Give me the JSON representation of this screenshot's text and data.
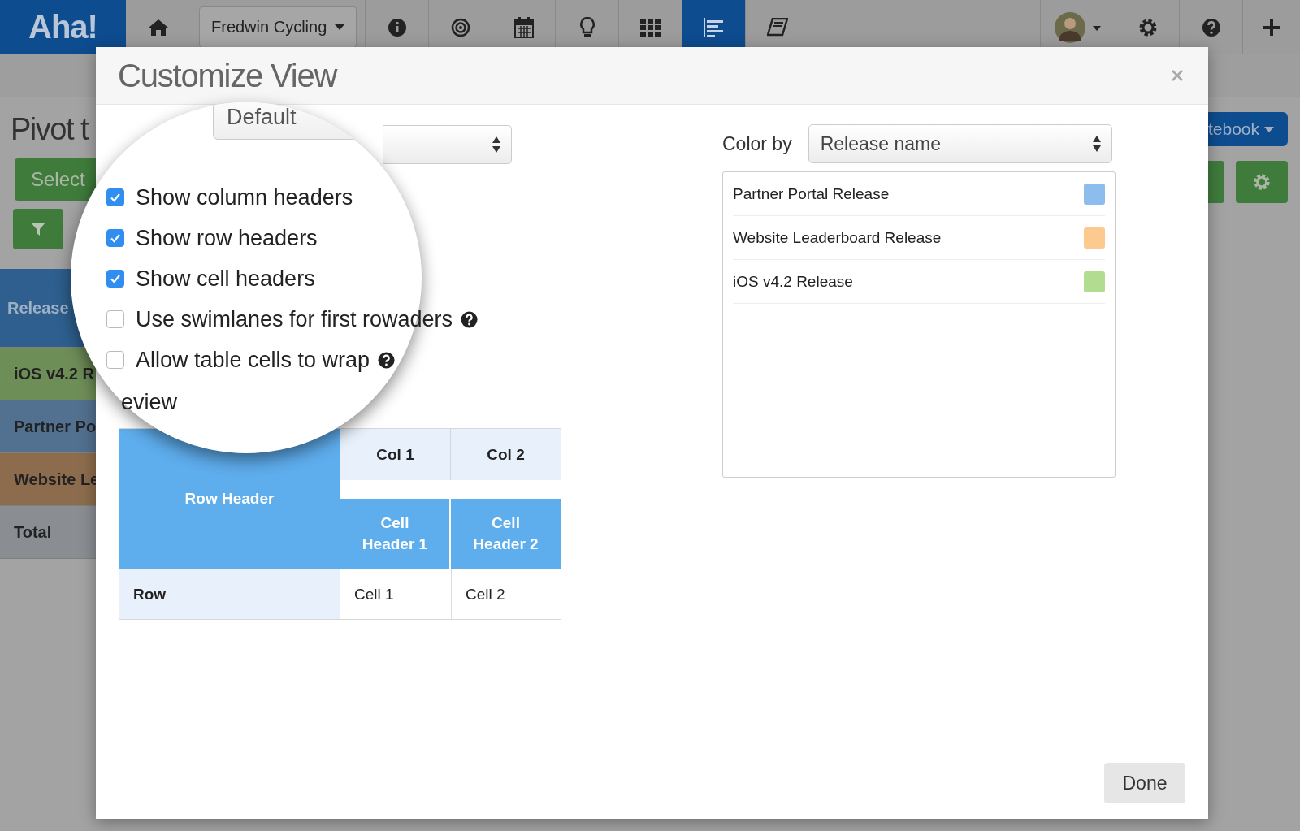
{
  "nav": {
    "logo": "Aha!",
    "workspace": "Fredwin Cycling",
    "items": [
      {
        "kind": "info",
        "selected": false
      },
      {
        "kind": "target",
        "selected": false
      },
      {
        "kind": "calendar",
        "selected": false
      },
      {
        "kind": "bulb",
        "selected": false
      },
      {
        "kind": "grid",
        "selected": false
      },
      {
        "kind": "list",
        "selected": true
      },
      {
        "kind": "book",
        "selected": false
      }
    ]
  },
  "page": {
    "title": "Pivot t",
    "select_button": "Select",
    "notebook_button": "tebook",
    "rows": [
      {
        "label": "Release",
        "color": "#2e5f8e"
      },
      {
        "label": "iOS v4.2 R",
        "color": "#6e8e58"
      },
      {
        "label": "Partner Po",
        "color": "#52708f"
      },
      {
        "label": "Website Le",
        "color": "#8c6c4c"
      },
      {
        "label": "Total",
        "color": "#8a8d92"
      }
    ]
  },
  "dialog": {
    "title": "Customize View",
    "theme_select": {
      "value": "Default"
    },
    "options": [
      {
        "label": "Show column headers",
        "checked": true,
        "help": false
      },
      {
        "label": "Show row headers",
        "checked": true,
        "help": false
      },
      {
        "label": "Show cell headers",
        "checked": true,
        "help": false
      },
      {
        "label": "Use swimlanes for first rowaders",
        "checked": false,
        "help": true
      },
      {
        "label": "Allow table cells to wrap",
        "checked": false,
        "help": true
      }
    ],
    "preview": {
      "label": "eview",
      "row_header": "Row Header",
      "columns": [
        "Col 1",
        "Col 2"
      ],
      "cell_headers": [
        "Cell Header 1",
        "Cell Header 2"
      ],
      "row": "Row",
      "cells": [
        "Cell 1",
        "Cell 2"
      ]
    },
    "color_by": {
      "label": "Color by",
      "value": "Release name",
      "items": [
        {
          "label": "Partner Portal Release",
          "color": "#8dbdec"
        },
        {
          "label": "Website Leaderboard Release",
          "color": "#fcca8f"
        },
        {
          "label": "iOS v4.2 Release",
          "color": "#b2dc8f"
        }
      ]
    },
    "done_button": "Done"
  }
}
